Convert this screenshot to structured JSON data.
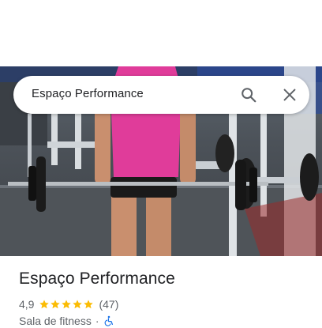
{
  "search": {
    "query": "Espaço Performance",
    "search_icon": "search-icon",
    "close_icon": "close-icon"
  },
  "photo": {
    "description_icon": "gym-photo"
  },
  "place": {
    "name": "Espaço Performance",
    "rating": "4,9",
    "stars": 5,
    "review_count": "(47)",
    "category": "Sala de fitness",
    "separator": "·",
    "accessibility_icon": "wheelchair-icon"
  },
  "colors": {
    "star": "#fbbc04",
    "wheelchair": "#1a73e8",
    "text_primary": "#202124",
    "text_secondary": "#5f6368"
  }
}
